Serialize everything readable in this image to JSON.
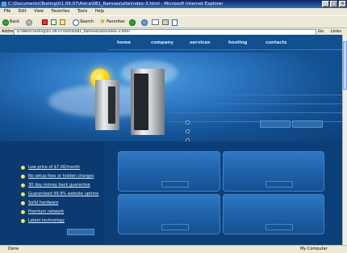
{
  "window": {
    "title": "C:\\Documents\\Testing\\01.09.07\\Astra\\081_Ramses\\site\\index-3.html - Microsoft Internet Explorer",
    "min": "_",
    "max": "□",
    "close": "×"
  },
  "menu": [
    "File",
    "Edit",
    "View",
    "Favorites",
    "Tools",
    "Help"
  ],
  "toolbar": {
    "back": "Back",
    "search": "Search",
    "favorites": "Favorites"
  },
  "address": {
    "label": "Address",
    "url": "D:\\Work\\Testing\\01.09.07\\Astra\\081_Ramses\\site\\index-3.html",
    "go": "Go",
    "links": "Links"
  },
  "nav": [
    "home",
    "company",
    "services",
    "hosting",
    "contacts"
  ],
  "features": [
    "Low price of $7.00/month",
    "No setup fees or hidden charges",
    "30 day money back guarantee",
    "Guaranteed 99.9% website uptime",
    "Solid hardware",
    "Premium network",
    "Latest technology"
  ],
  "status": {
    "left": "Done",
    "right": "My Computer"
  },
  "colors": {
    "page_bg": "#0c3f78",
    "nav_bg": "#11508f",
    "accent": "#2f76c2",
    "bullet": "#e8c000"
  }
}
